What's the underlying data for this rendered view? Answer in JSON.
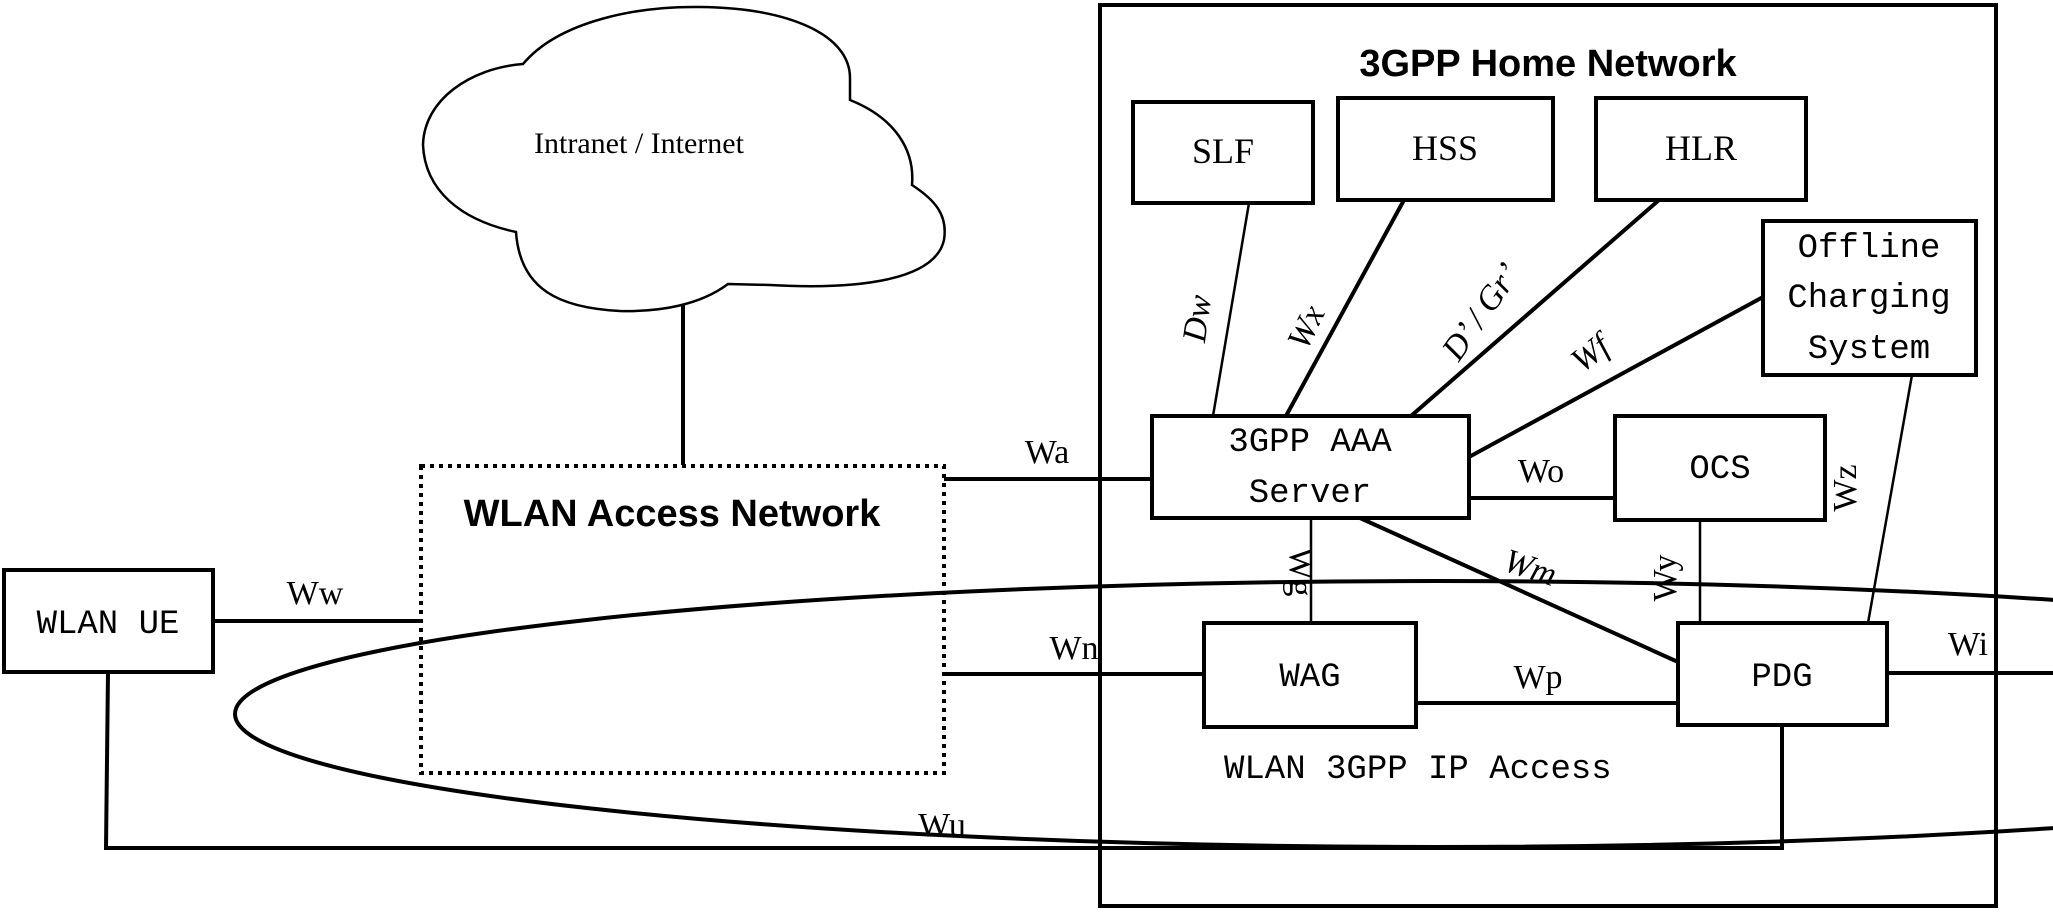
{
  "regions": {
    "home_network": {
      "title": "3GPP Home Network"
    },
    "wlan_access_network": {
      "title": "WLAN Access Network"
    },
    "internet_cloud": {
      "label": "Intranet / Internet"
    },
    "ip_access_ellipse": {
      "label": "WLAN 3GPP IP Access"
    }
  },
  "nodes": {
    "wlan_ue": {
      "label": "WLAN UE"
    },
    "slf": {
      "label": "SLF"
    },
    "hss": {
      "label": "HSS"
    },
    "hlr": {
      "label": "HLR"
    },
    "ocs_offline": {
      "lines": [
        "Offline",
        "Charging",
        "System"
      ]
    },
    "aaa": {
      "lines": [
        "3GPP AAA",
        "Server"
      ]
    },
    "ocs": {
      "label": "OCS"
    },
    "wag": {
      "label": "WAG"
    },
    "pdg": {
      "label": "PDG"
    }
  },
  "interfaces": {
    "ww": "Ww",
    "wa": "Wa",
    "wn": "Wn",
    "wu": "Wu",
    "dw": "Dw",
    "wx": "Wx",
    "d_gr": "D’ / Gr’",
    "wf": "Wf",
    "wo": "Wo",
    "wg": "Wg",
    "wm": "Wm",
    "wy": "Wy",
    "wz": "Wz",
    "wp": "Wp",
    "wi": "Wi"
  }
}
